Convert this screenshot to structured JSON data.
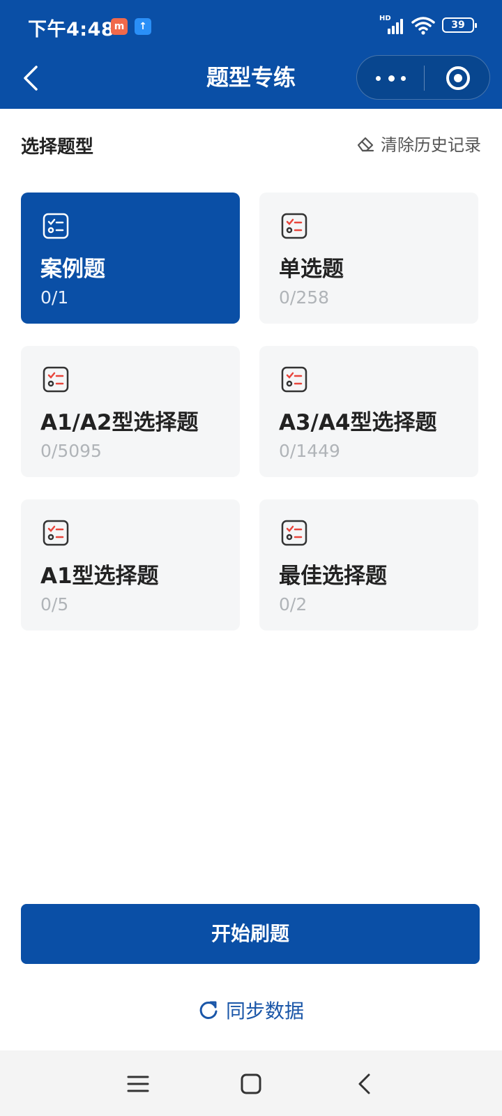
{
  "status_bar": {
    "time": "下午4:48",
    "battery": "39",
    "signal_label": "HD"
  },
  "nav": {
    "title": "题型专练"
  },
  "section": {
    "title": "选择题型",
    "clear_history": "清除历史记录"
  },
  "cards": [
    {
      "title": "案例题",
      "count": "0/1",
      "active": true
    },
    {
      "title": "单选题",
      "count": "0/258",
      "active": false
    },
    {
      "title": "A1/A2型选择题",
      "count": "0/5095",
      "active": false
    },
    {
      "title": "A3/A4型选择题",
      "count": "0/1449",
      "active": false
    },
    {
      "title": "A1型选择题",
      "count": "0/5",
      "active": false
    },
    {
      "title": "最佳选择题",
      "count": "0/2",
      "active": false
    }
  ],
  "actions": {
    "start": "开始刷题",
    "sync": "同步数据"
  },
  "colors": {
    "primary": "#0a4fa6",
    "card_bg": "#f5f6f7",
    "icon_accent": "#e8453c",
    "muted_text": "#b0b4b8"
  },
  "icons": {
    "back": "chevron-left-icon",
    "more": "more-dots-icon",
    "close_target": "target-icon",
    "clear": "eraser-icon",
    "card": "checklist-icon",
    "sync": "refresh-icon"
  }
}
